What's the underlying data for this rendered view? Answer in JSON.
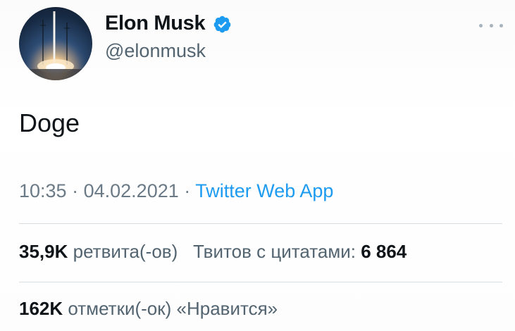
{
  "author": {
    "name": "Elon Musk",
    "handle": "@elonmusk",
    "verified": true,
    "avatar_icon": "rocket-launch-avatar",
    "verified_color": "#1d9bf0"
  },
  "more_icon": "ellipsis-icon",
  "tweet": {
    "text": "Doge"
  },
  "meta": {
    "time": "10:35",
    "separator": "·",
    "date": "04.02.2021",
    "source": "Twitter Web App",
    "source_color": "#1d9bf0"
  },
  "stats": {
    "retweets_count": "35,9K",
    "retweets_label": "ретвита(-ов)",
    "quotes_label": "Твитов с цитатами:",
    "quotes_count": "6 864",
    "likes_count": "162K",
    "likes_label": "отметки(-ок) «Нравится»"
  }
}
